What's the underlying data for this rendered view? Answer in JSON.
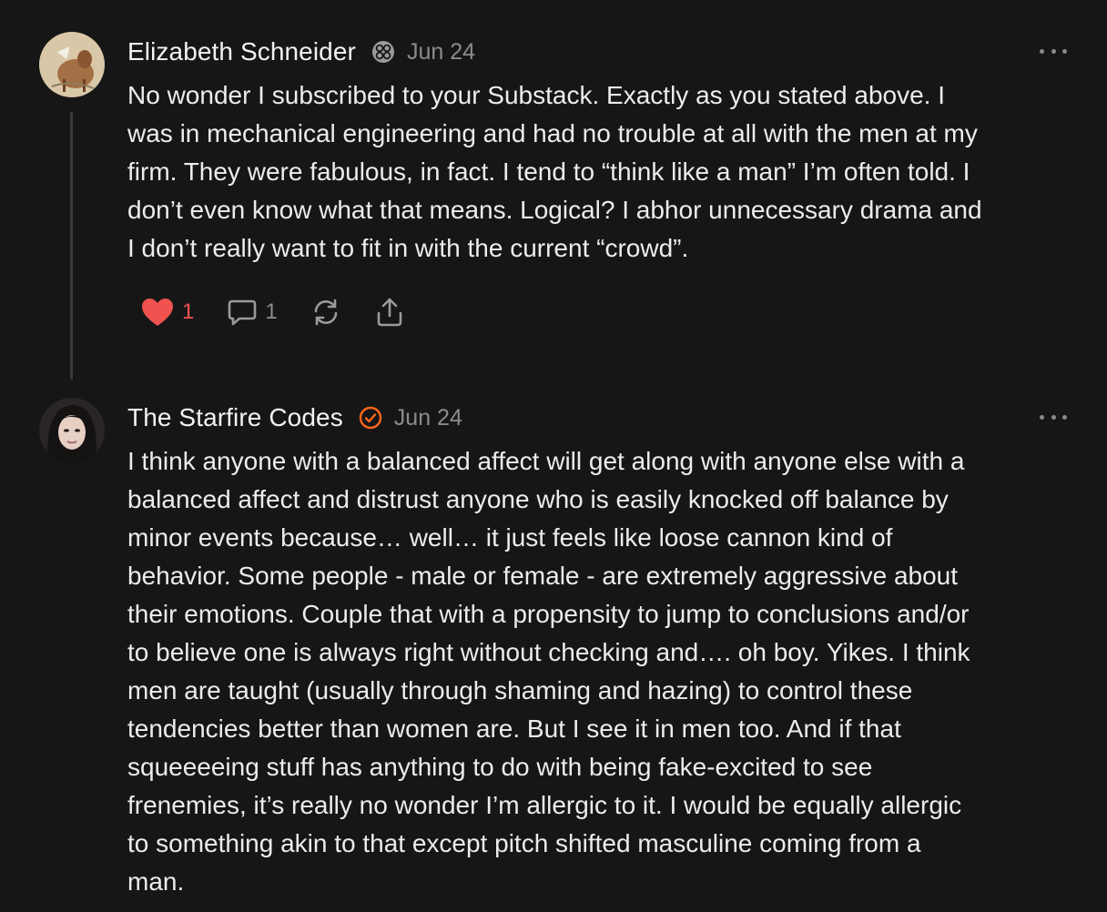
{
  "comments": [
    {
      "author": "Elizabeth Schneider",
      "badge_icon": "flower-badge-icon",
      "date": "Jun 24",
      "text": "No wonder I subscribed to your Substack. Exactly as you stated above. I\nwas in mechanical engineering and had no trouble at all with the men at my\nfirm. They were fabulous, in fact. I tend to “think like a man” I’m often told. I\ndon’t even know what that means. Logical? I abhor unnecessary drama and\nI don’t really want to fit in with the current “crowd”.",
      "likes": "1",
      "replies": "1",
      "liked": true
    },
    {
      "author": "The Starfire Codes",
      "badge_icon": "check-circle-badge-icon",
      "date": "Jun 24",
      "text": "I think anyone with a balanced affect will get along with anyone else with a\nbalanced affect and distrust anyone who is easily knocked off balance by\nminor events because… well… it just feels like loose cannon kind of\nbehavior. Some people - male or female - are extremely aggressive about\ntheir emotions. Couple that with a propensity to jump to conclusions and/or\nto believe one is always right without checking and…. oh boy. Yikes. I think\nmen are taught (usually through shaming and hazing) to control these\ntendencies better than women are. But I see it in men too. And if that\nsqueeeeing stuff has anything to do with being fake-excited to see\nfrenemies, it’s really no wonder I’m allergic to it. I would be equally allergic\nto something akin to that except pitch shifted masculine coming from a\nman."
    }
  ],
  "colors": {
    "background": "#161616",
    "like_accent": "#f0524f",
    "verified_accent": "#ff6719",
    "muted": "#8c8c8c"
  }
}
